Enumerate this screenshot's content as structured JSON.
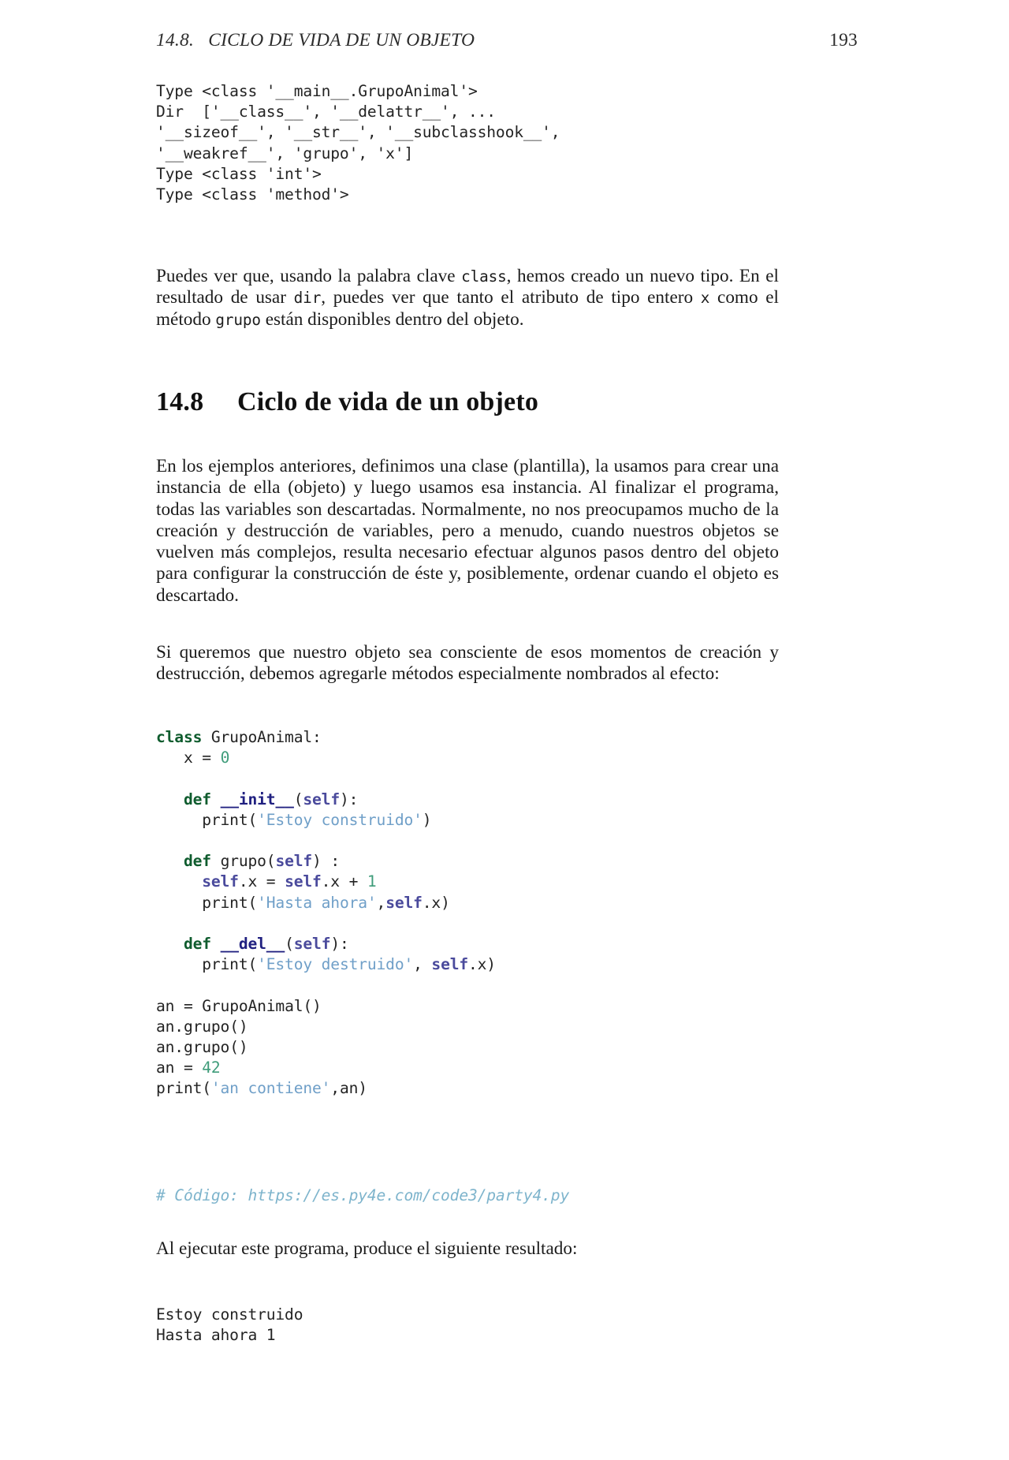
{
  "page": {
    "number": "193",
    "running_head": "14.8.   CICLO DE VIDA DE UN OBJETO"
  },
  "output_block_1": {
    "lines": [
      "Type <class '__main__.GrupoAnimal'>",
      "Dir  ['__class__', '__delattr__', ...",
      "'__sizeof__', '__str__', '__subclasshook__',",
      "'__weakref__', 'grupo', 'x']",
      "Type <class 'int'>",
      "Type <class 'method'>"
    ],
    "text": "Type <class '__main__.GrupoAnimal'>\nDir  ['__class__', '__delattr__', ...\n'__sizeof__', '__str__', '__subclasshook__',\n'__weakref__', 'grupo', 'x']\nType <class 'int'>\nType <class 'method'>"
  },
  "paragraph_1": {
    "segments": [
      {
        "kind": "text",
        "value": "Puedes ver que, usando la palabra clave "
      },
      {
        "kind": "code",
        "value": "class"
      },
      {
        "kind": "text",
        "value": ", hemos creado un nuevo tipo. En el resultado de usar "
      },
      {
        "kind": "code",
        "value": "dir"
      },
      {
        "kind": "text",
        "value": ", puedes ver que tanto el atributo de tipo entero "
      },
      {
        "kind": "code",
        "value": "x"
      },
      {
        "kind": "text",
        "value": " como el método "
      },
      {
        "kind": "code",
        "value": "grupo"
      },
      {
        "kind": "text",
        "value": " están disponibles dentro del objeto."
      }
    ],
    "s0": "Puedes ver que, usando la palabra clave ",
    "s1": "class",
    "s2": ", hemos creado un nuevo tipo. En el resultado de usar ",
    "s3": "dir",
    "s4": ", puedes ver que tanto el atributo de tipo entero ",
    "s5": "x",
    "s6": " como el método ",
    "s7": "grupo",
    "s8": " están disponibles dentro del objeto."
  },
  "section_heading": {
    "number": "14.8",
    "title": "Ciclo de vida de un objeto"
  },
  "paragraph_2": {
    "text": "En los ejemplos anteriores, definimos una clase (plantilla), la usamos para crear una instancia de ella (objeto) y luego usamos esa instancia.  Al finalizar el programa, todas las variables son descartadas. Normalmente, no nos preocupamos mucho de la creación y destrucción de variables, pero a menudo, cuando nuestros objetos se vuelven más complejos, resulta necesario efectuar algunos pasos dentro del objeto para configurar la construcción de éste y, posiblemente, ordenar cuando el objeto es descartado."
  },
  "paragraph_3": {
    "text": "Si queremos que nuestro objeto sea consciente de esos momentos de creación y destrucción, debemos agregarle métodos especialmente nombrados al efecto:"
  },
  "code_block": {
    "language": "python",
    "lines": [
      "class GrupoAnimal:",
      "   x = 0",
      "",
      "   def __init__(self):",
      "     print('Estoy construido')",
      "",
      "   def grupo(self) :",
      "     self.x = self.x + 1",
      "     print('Hasta ahora',self.x)",
      "",
      "   def __del__(self):",
      "     print('Estoy destruido', self.x)",
      "",
      "an = GrupoAnimal()",
      "an.grupo()",
      "an.grupo()",
      "an = 42",
      "print('an contiene',an)"
    ],
    "tokens": {
      "kw_class": "class",
      "kw_def": "def",
      "name_class": "GrupoAnimal",
      "attr_x": "x",
      "num_zero": "0",
      "num_one": "1",
      "num_42": "42",
      "dunder_init": "__init__",
      "dunder_del": "__del__",
      "self": "self",
      "method_grupo": "grupo",
      "fn_print": "print",
      "str_construido": "'Estoy construido'",
      "str_hasta": "'Hasta ahora'",
      "str_destruido": "'Estoy destruido'",
      "str_contiene": "'an contiene'",
      "var_an": "an"
    }
  },
  "code_comment": {
    "text": "# Código: https://es.py4e.com/code3/party4.py"
  },
  "paragraph_4": {
    "text": "Al ejecutar este programa, produce el siguiente resultado:"
  },
  "output_block_2": {
    "lines": [
      "Estoy construido",
      "Hasta ahora 1"
    ],
    "text": "Estoy construido\nHasta ahora 1"
  },
  "colors": {
    "keyword": "#0f5c2e",
    "function": "#202080",
    "self": "#4a4a9c",
    "number": "#3f9c7a",
    "string": "#6f9fc8",
    "comment": "#7eb4cc",
    "body_text": "#1c1c1c",
    "page_bg": "#ffffff"
  }
}
